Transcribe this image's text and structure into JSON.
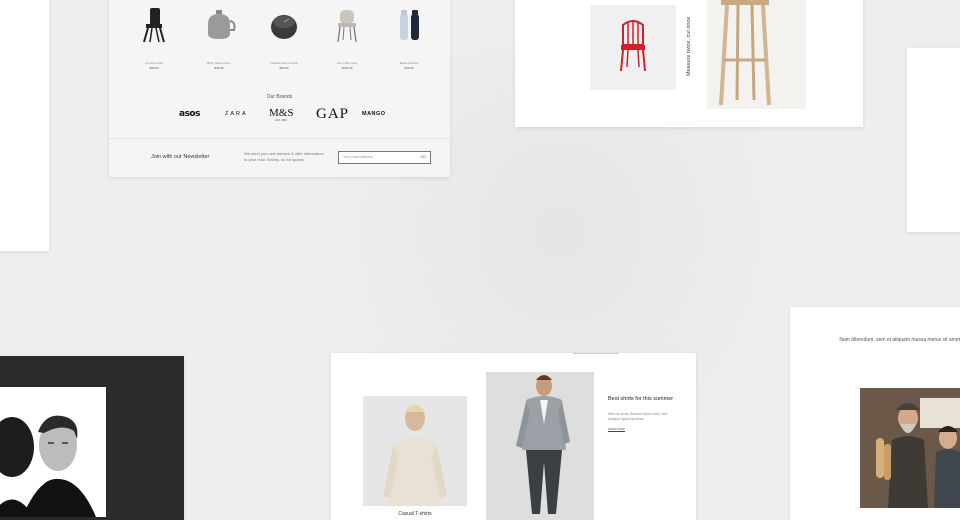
{
  "products": [
    {
      "icon": "black-chair-icon",
      "name": "Corona Chair",
      "price": "$99.00"
    },
    {
      "icon": "teapot-icon",
      "name": "Bitsy Teapot Grey",
      "price": "$49.00"
    },
    {
      "icon": "clock-icon",
      "name": "Tumbler Alarm Clock",
      "price": "$59.00"
    },
    {
      "icon": "grey-chair-icon",
      "name": "Ace Chair Grey",
      "price": "$249.00"
    },
    {
      "icon": "grinders-icon",
      "name": "Bottle Grinder",
      "price": "$49.00"
    }
  ],
  "brands": {
    "title": "Our Brands",
    "items": [
      "asos",
      "ZARA",
      "M&S",
      "GAP",
      "MANGO"
    ],
    "ms_sub": "EST. 1884"
  },
  "newsletter": {
    "title": "Join with our Newsletter",
    "text": "We send you new release & offer information to your mail. Strictly, no for spams.",
    "placeholder": "Your email address",
    "button": "GO"
  },
  "stool_card": {
    "vertical_text": "Measure twice, cut once"
  },
  "fashion_card": {
    "caption": "Casual T-shirts",
    "title": "Best shirts for this summer",
    "text": "Nam at lacus. Aenean dolor nunc, sed tristique ligula faucibus.",
    "link": "SHOP NOW"
  },
  "bakers_card": {
    "text": "Nam bibendum, sem et aliquam massa metus sit amet"
  },
  "colors": {
    "accent_red": "#d11f2b",
    "dark_panel": "#2b2b2b",
    "page_bg": "#eeeeee"
  }
}
